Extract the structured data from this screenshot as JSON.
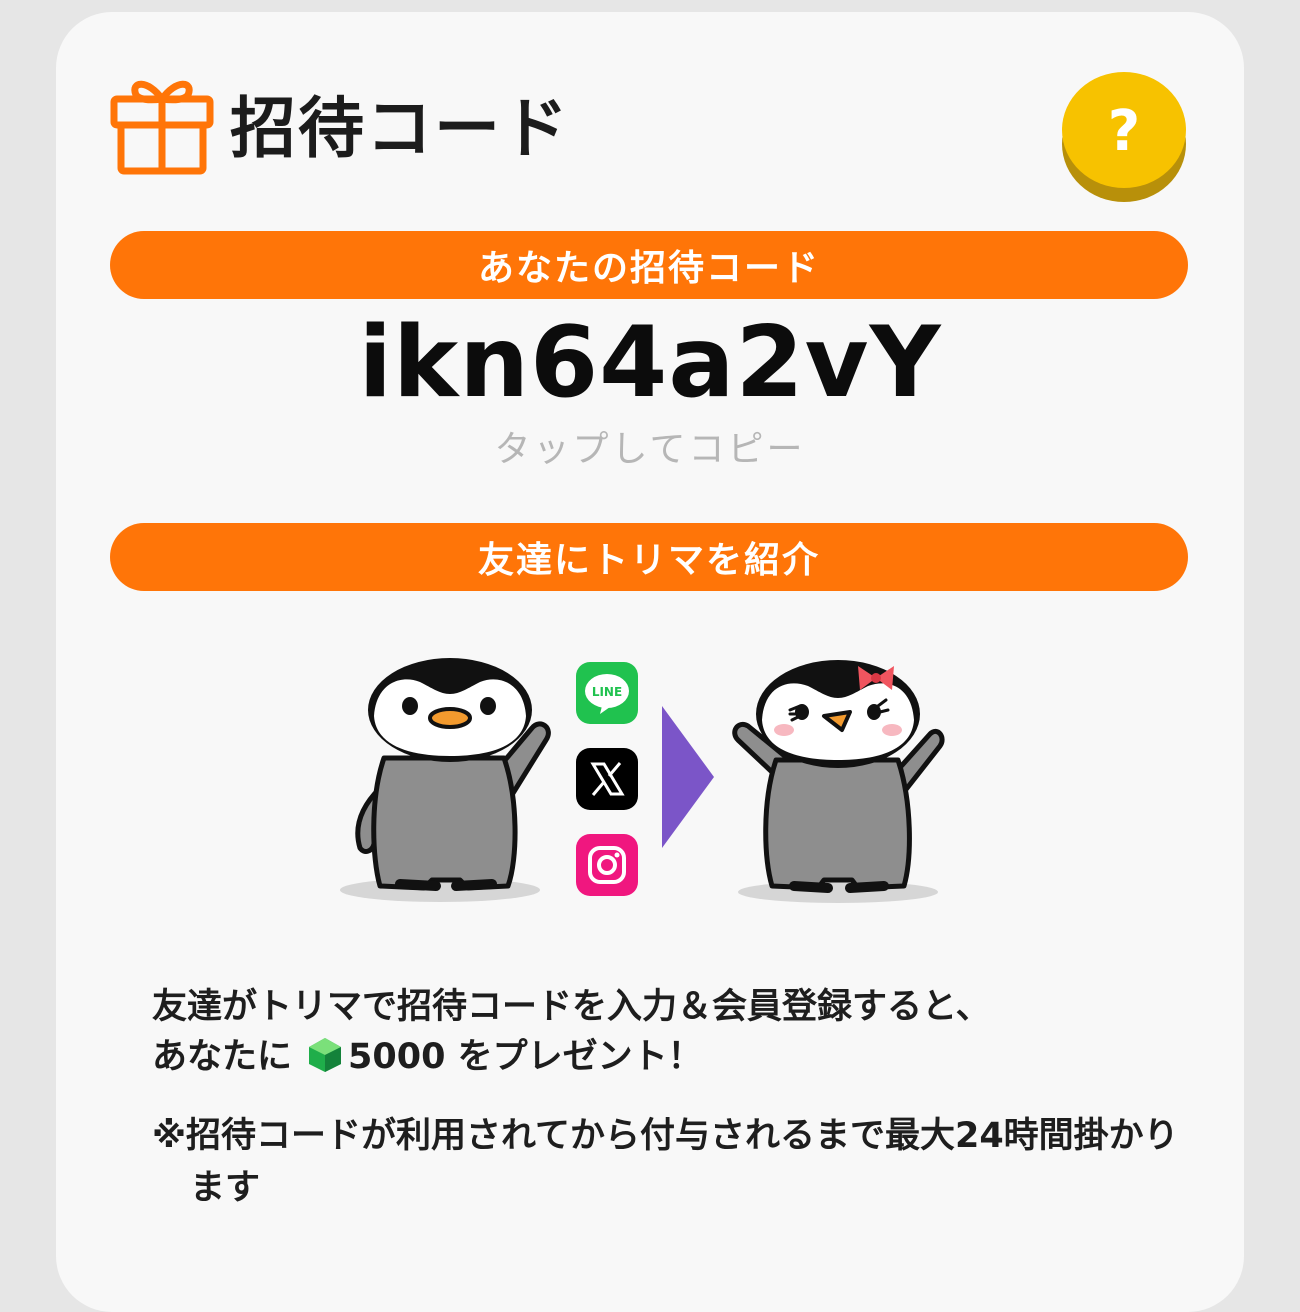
{
  "header": {
    "title": "招待コード",
    "help_symbol": "?"
  },
  "invite": {
    "label": "あなたの招待コード",
    "code": "ikn64a2vY",
    "copy_hint": "タップしてコピー"
  },
  "share": {
    "label": "友達にトリマを紹介",
    "icons": [
      "line-icon",
      "x-icon",
      "instagram-icon"
    ],
    "line_text": "LINE"
  },
  "description": {
    "line1": "友達がトリマで招待コードを入力＆会員登録すると、",
    "line2_prefix": "あなたに",
    "reward_amount": "5000",
    "line2_suffix": " をプレゼント！",
    "note": "※招待コードが利用されてから付与されるまで最大24時間掛かります"
  },
  "colors": {
    "accent": "#ff7508",
    "help_button": "#f7c200",
    "arrow": "#7b55c8",
    "line_green": "#20c24f",
    "instagram_pink": "#f0177f"
  }
}
